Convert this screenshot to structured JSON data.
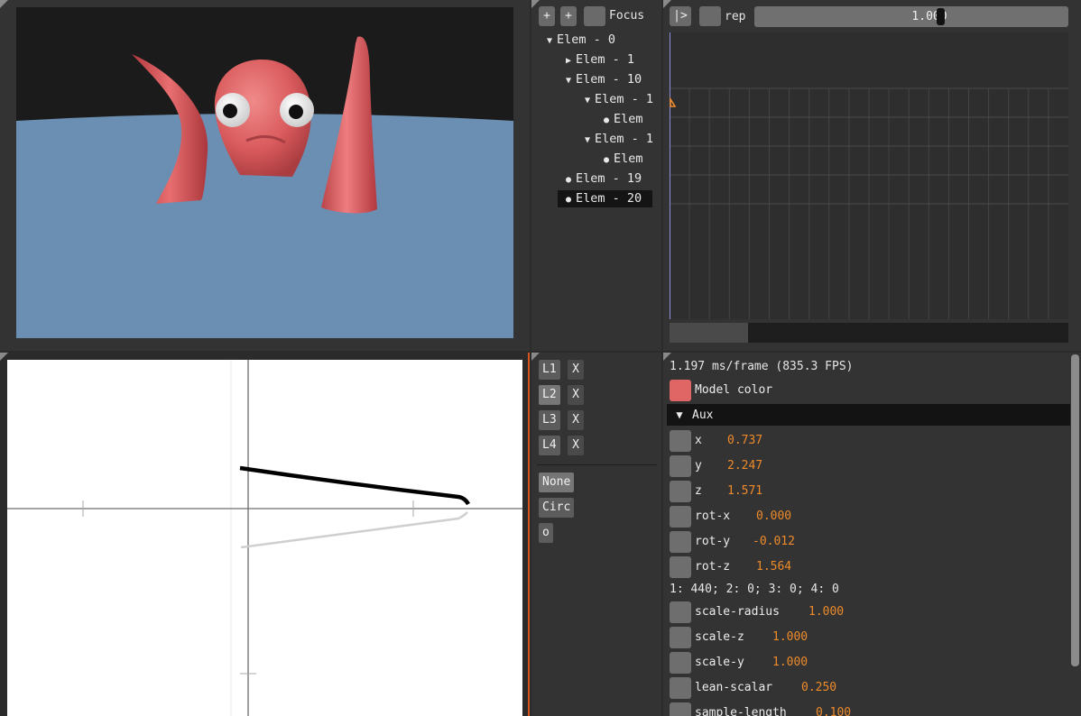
{
  "colors": {
    "model": "#e06666",
    "water": "#6b8fb3",
    "sky": "#1b1b1b",
    "accent": "#ee8a2a"
  },
  "tree": {
    "add1": "+",
    "add2": "+",
    "focus_label": "Focus",
    "rows": [
      {
        "glyph": "▼",
        "label": "Elem - 0"
      },
      {
        "glyph": "▶",
        "label": "Elem - 1"
      },
      {
        "glyph": "▼",
        "label": "Elem - 10"
      },
      {
        "glyph": "▼",
        "label": "Elem - 1"
      },
      {
        "glyph": "●",
        "label": "Elem"
      },
      {
        "glyph": "▼",
        "label": "Elem - 1"
      },
      {
        "glyph": "●",
        "label": "Elem"
      },
      {
        "glyph": "●",
        "label": "Elem - 19"
      },
      {
        "glyph": "●",
        "label": "Elem - 20"
      }
    ]
  },
  "timeline": {
    "play_label": "|>",
    "rep_label": "rep",
    "value": "1.000"
  },
  "layers": {
    "items": [
      {
        "label": "L1",
        "remove": "X"
      },
      {
        "label": "L2",
        "remove": "X"
      },
      {
        "label": "L3",
        "remove": "X"
      },
      {
        "label": "L4",
        "remove": "X"
      }
    ],
    "modes": [
      "None",
      "Circ",
      "o"
    ]
  },
  "inspector": {
    "fps": "1.197 ms/frame (835.3 FPS)",
    "model_color_label": "Model color",
    "aux_label": "Aux",
    "counts": "1: 440; 2: 0; 3: 0; 4: 0",
    "params": [
      {
        "name": "x",
        "value": "0.737"
      },
      {
        "name": "y",
        "value": "2.247"
      },
      {
        "name": "z",
        "value": "1.571"
      },
      {
        "name": "rot-x",
        "value": "0.000"
      },
      {
        "name": "rot-y",
        "value": "-0.012"
      },
      {
        "name": "rot-z",
        "value": "1.564"
      }
    ],
    "scale_params": [
      {
        "name": "scale-radius",
        "value": "1.000"
      },
      {
        "name": "scale-z",
        "value": "1.000"
      },
      {
        "name": "scale-y",
        "value": "1.000"
      },
      {
        "name": "lean-scalar",
        "value": "0.250"
      },
      {
        "name": "sample-length",
        "value": "0.100"
      }
    ]
  }
}
